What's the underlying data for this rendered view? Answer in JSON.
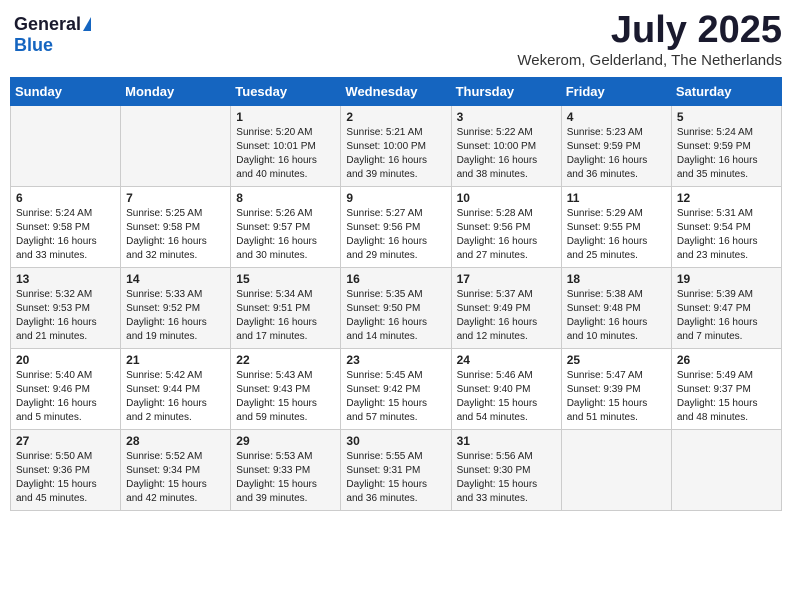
{
  "header": {
    "logo_general": "General",
    "logo_blue": "Blue",
    "month_title": "July 2025",
    "location": "Wekerom, Gelderland, The Netherlands"
  },
  "days_of_week": [
    "Sunday",
    "Monday",
    "Tuesday",
    "Wednesday",
    "Thursday",
    "Friday",
    "Saturday"
  ],
  "weeks": [
    [
      {
        "num": "",
        "info": ""
      },
      {
        "num": "",
        "info": ""
      },
      {
        "num": "1",
        "info": "Sunrise: 5:20 AM\nSunset: 10:01 PM\nDaylight: 16 hours and 40 minutes."
      },
      {
        "num": "2",
        "info": "Sunrise: 5:21 AM\nSunset: 10:00 PM\nDaylight: 16 hours and 39 minutes."
      },
      {
        "num": "3",
        "info": "Sunrise: 5:22 AM\nSunset: 10:00 PM\nDaylight: 16 hours and 38 minutes."
      },
      {
        "num": "4",
        "info": "Sunrise: 5:23 AM\nSunset: 9:59 PM\nDaylight: 16 hours and 36 minutes."
      },
      {
        "num": "5",
        "info": "Sunrise: 5:24 AM\nSunset: 9:59 PM\nDaylight: 16 hours and 35 minutes."
      }
    ],
    [
      {
        "num": "6",
        "info": "Sunrise: 5:24 AM\nSunset: 9:58 PM\nDaylight: 16 hours and 33 minutes."
      },
      {
        "num": "7",
        "info": "Sunrise: 5:25 AM\nSunset: 9:58 PM\nDaylight: 16 hours and 32 minutes."
      },
      {
        "num": "8",
        "info": "Sunrise: 5:26 AM\nSunset: 9:57 PM\nDaylight: 16 hours and 30 minutes."
      },
      {
        "num": "9",
        "info": "Sunrise: 5:27 AM\nSunset: 9:56 PM\nDaylight: 16 hours and 29 minutes."
      },
      {
        "num": "10",
        "info": "Sunrise: 5:28 AM\nSunset: 9:56 PM\nDaylight: 16 hours and 27 minutes."
      },
      {
        "num": "11",
        "info": "Sunrise: 5:29 AM\nSunset: 9:55 PM\nDaylight: 16 hours and 25 minutes."
      },
      {
        "num": "12",
        "info": "Sunrise: 5:31 AM\nSunset: 9:54 PM\nDaylight: 16 hours and 23 minutes."
      }
    ],
    [
      {
        "num": "13",
        "info": "Sunrise: 5:32 AM\nSunset: 9:53 PM\nDaylight: 16 hours and 21 minutes."
      },
      {
        "num": "14",
        "info": "Sunrise: 5:33 AM\nSunset: 9:52 PM\nDaylight: 16 hours and 19 minutes."
      },
      {
        "num": "15",
        "info": "Sunrise: 5:34 AM\nSunset: 9:51 PM\nDaylight: 16 hours and 17 minutes."
      },
      {
        "num": "16",
        "info": "Sunrise: 5:35 AM\nSunset: 9:50 PM\nDaylight: 16 hours and 14 minutes."
      },
      {
        "num": "17",
        "info": "Sunrise: 5:37 AM\nSunset: 9:49 PM\nDaylight: 16 hours and 12 minutes."
      },
      {
        "num": "18",
        "info": "Sunrise: 5:38 AM\nSunset: 9:48 PM\nDaylight: 16 hours and 10 minutes."
      },
      {
        "num": "19",
        "info": "Sunrise: 5:39 AM\nSunset: 9:47 PM\nDaylight: 16 hours and 7 minutes."
      }
    ],
    [
      {
        "num": "20",
        "info": "Sunrise: 5:40 AM\nSunset: 9:46 PM\nDaylight: 16 hours and 5 minutes."
      },
      {
        "num": "21",
        "info": "Sunrise: 5:42 AM\nSunset: 9:44 PM\nDaylight: 16 hours and 2 minutes."
      },
      {
        "num": "22",
        "info": "Sunrise: 5:43 AM\nSunset: 9:43 PM\nDaylight: 15 hours and 59 minutes."
      },
      {
        "num": "23",
        "info": "Sunrise: 5:45 AM\nSunset: 9:42 PM\nDaylight: 15 hours and 57 minutes."
      },
      {
        "num": "24",
        "info": "Sunrise: 5:46 AM\nSunset: 9:40 PM\nDaylight: 15 hours and 54 minutes."
      },
      {
        "num": "25",
        "info": "Sunrise: 5:47 AM\nSunset: 9:39 PM\nDaylight: 15 hours and 51 minutes."
      },
      {
        "num": "26",
        "info": "Sunrise: 5:49 AM\nSunset: 9:37 PM\nDaylight: 15 hours and 48 minutes."
      }
    ],
    [
      {
        "num": "27",
        "info": "Sunrise: 5:50 AM\nSunset: 9:36 PM\nDaylight: 15 hours and 45 minutes."
      },
      {
        "num": "28",
        "info": "Sunrise: 5:52 AM\nSunset: 9:34 PM\nDaylight: 15 hours and 42 minutes."
      },
      {
        "num": "29",
        "info": "Sunrise: 5:53 AM\nSunset: 9:33 PM\nDaylight: 15 hours and 39 minutes."
      },
      {
        "num": "30",
        "info": "Sunrise: 5:55 AM\nSunset: 9:31 PM\nDaylight: 15 hours and 36 minutes."
      },
      {
        "num": "31",
        "info": "Sunrise: 5:56 AM\nSunset: 9:30 PM\nDaylight: 15 hours and 33 minutes."
      },
      {
        "num": "",
        "info": ""
      },
      {
        "num": "",
        "info": ""
      }
    ]
  ]
}
